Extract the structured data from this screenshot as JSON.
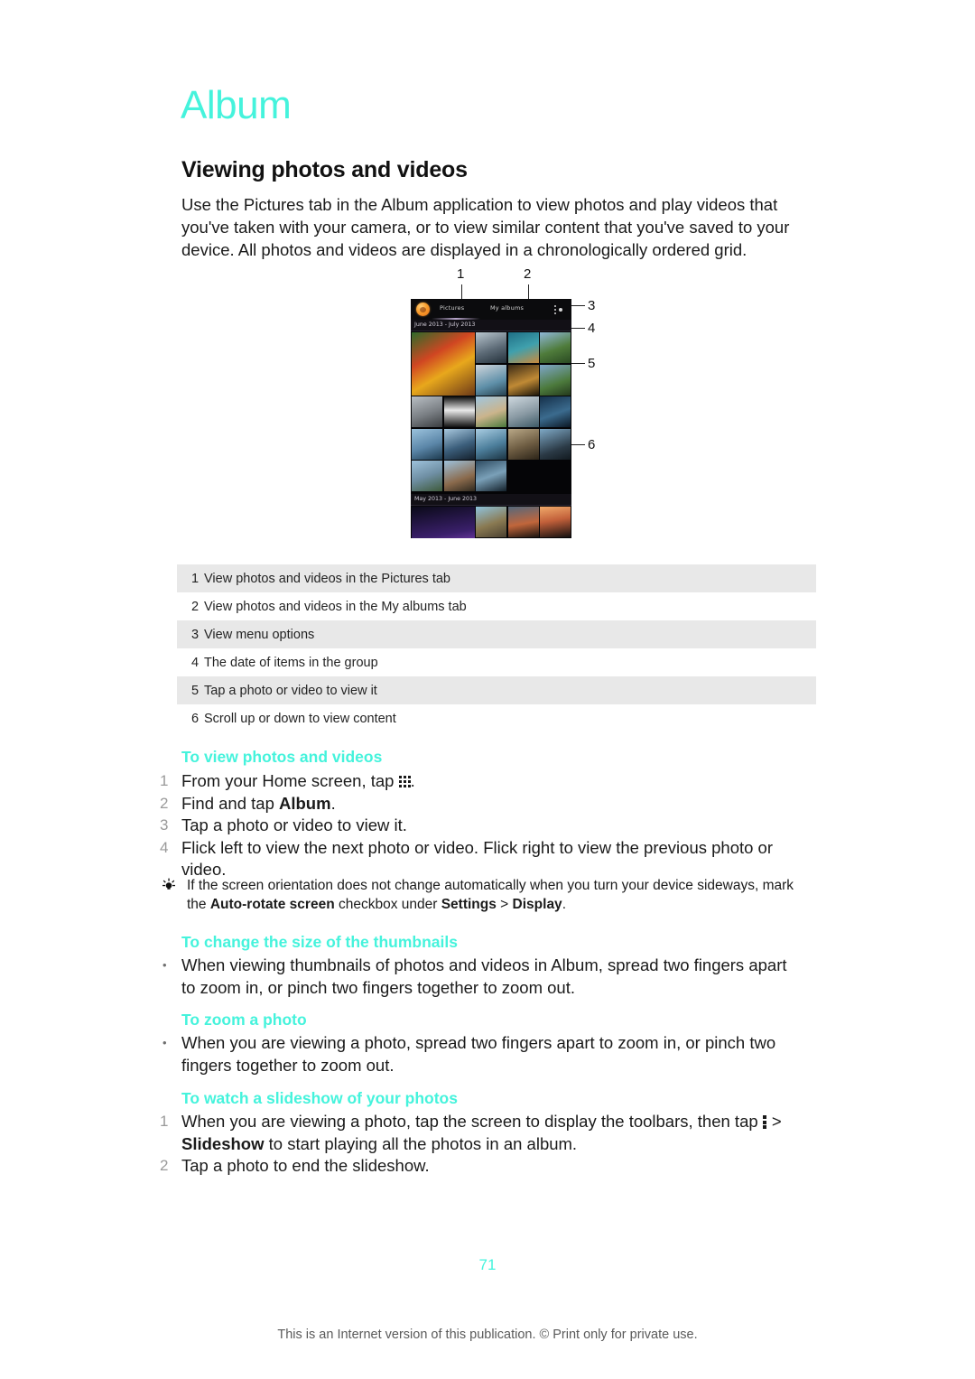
{
  "document": {
    "chapter_title": "Album",
    "section_title": "Viewing photos and videos",
    "intro": "Use the Pictures tab in the Album application to view photos and play videos that you've taken with your camera, or to view similar content that you've saved to your device. All photos and videos are displayed in a chronologically ordered grid.",
    "page_number": "71",
    "footer_note": "This is an Internet version of this publication. © Print only for private use."
  },
  "figure": {
    "callouts": [
      "1",
      "2",
      "3",
      "4",
      "5",
      "6"
    ],
    "device": {
      "tabs": [
        {
          "label": "Pictures",
          "selected": true
        },
        {
          "label": "My albums",
          "selected": false
        }
      ],
      "menu_icon": "overflow-menu-icon",
      "app_icon": "album-app-icon",
      "groups": [
        {
          "date_label": "June 2013 - July 2013"
        },
        {
          "date_label": "May 2013 - June 2013"
        }
      ]
    }
  },
  "legend": {
    "rows": [
      {
        "num": "1",
        "text": "View photos and videos in the Pictures tab"
      },
      {
        "num": "2",
        "text": "View photos and videos in the My albums tab"
      },
      {
        "num": "3",
        "text": "View menu options"
      },
      {
        "num": "4",
        "text": "The date of items in the group"
      },
      {
        "num": "5",
        "text": "Tap a photo or video to view it"
      },
      {
        "num": "6",
        "text": "Scroll up or down to view content"
      }
    ]
  },
  "procedures": [
    {
      "heading": "To view photos and videos",
      "steps": [
        {
          "marker": "1",
          "pre": "From your Home screen, tap ",
          "icon": "apps-grid-icon",
          "post": "."
        },
        {
          "marker": "2",
          "pre": "Find and tap ",
          "bold": "Album",
          "post": "."
        },
        {
          "marker": "3",
          "pre": "Tap a photo or video to view it.",
          "post": ""
        },
        {
          "marker": "4",
          "pre": "Flick left to view the next photo or video. Flick right to view the previous photo or video.",
          "post": ""
        }
      ]
    },
    {
      "heading": "To change the size of the thumbnails",
      "steps": [
        {
          "marker": "•",
          "pre": "When viewing thumbnails of photos and videos in Album, spread two fingers apart to zoom in, or pinch two fingers together to zoom out.",
          "post": ""
        }
      ]
    },
    {
      "heading": "To zoom a photo",
      "steps": [
        {
          "marker": "•",
          "pre": "When you are viewing a photo, spread two fingers apart to zoom in, or pinch two fingers together to zoom out.",
          "post": ""
        }
      ]
    },
    {
      "heading": "To watch a slideshow of your photos",
      "steps": [
        {
          "marker": "1",
          "pre": "When you are viewing a photo, tap the screen to display the toolbars, then tap ",
          "icon": "overflow-menu-icon",
          "mid": " > ",
          "bold": "Slideshow",
          "post": " to start playing all the photos in an album."
        },
        {
          "marker": "2",
          "pre": "Tap a photo to end the slideshow.",
          "post": ""
        }
      ]
    }
  ],
  "tip": {
    "icon": "lightbulb-icon",
    "pre": "If the screen orientation does not change automatically when you turn your device sideways, mark the ",
    "bold1": "Auto-rotate screen",
    "mid1": " checkbox under ",
    "bold2": "Settings",
    "mid2": " > ",
    "bold3": "Display",
    "post": "."
  },
  "colors": {
    "accent_cyan": "#45f3dc",
    "body_text": "#1a1a1a",
    "table_shade": "#e8e8e8",
    "marker_grey": "#9a9a9a"
  }
}
